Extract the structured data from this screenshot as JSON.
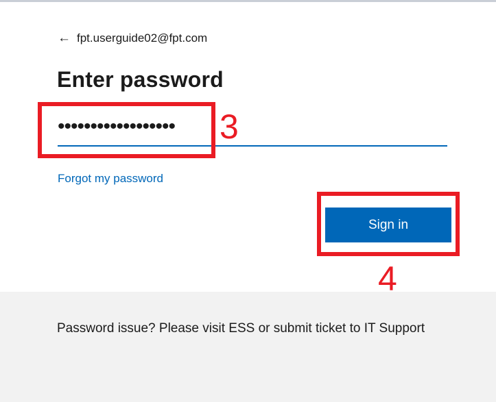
{
  "account": {
    "email": "fpt.userguide02@fpt.com",
    "back_icon": "arrow-left-icon"
  },
  "heading": "Enter password",
  "password": {
    "masked_value": "••••••••••••••••••"
  },
  "links": {
    "forgot": "Forgot my password"
  },
  "buttons": {
    "sign_in": "Sign in"
  },
  "annotations": {
    "step_password": "3",
    "step_sign_in": "4",
    "highlight_color": "#ea1c24"
  },
  "footer": {
    "message": "Password issue? Please visit ESS or submit ticket to IT Support"
  },
  "colors": {
    "accent": "#0067b8",
    "footer_bg": "#f2f2f2"
  }
}
